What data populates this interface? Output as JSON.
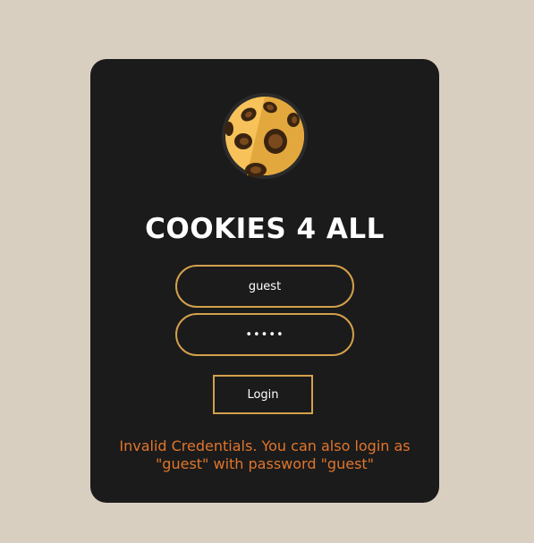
{
  "app": {
    "title": "COOKIES 4 ALL",
    "logo_icon": "cookie-icon"
  },
  "form": {
    "username_value": "guest",
    "password_value": "guest",
    "login_label": "Login"
  },
  "message": {
    "error_text": "Invalid Credentials. You can also login as \"guest\" with password \"guest\""
  },
  "colors": {
    "background": "#d9cfc1",
    "card": "#1b1b1b",
    "accent": "#d4a04c",
    "error": "#e0752c"
  }
}
